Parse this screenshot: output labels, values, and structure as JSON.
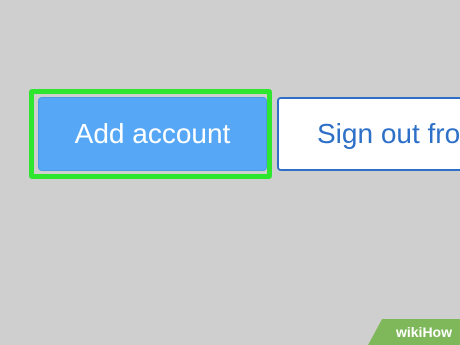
{
  "buttons": {
    "add_account_label": "Add account",
    "sign_out_label": "Sign out from"
  },
  "watermark": {
    "part1": "wiki",
    "part2": "How"
  },
  "colors": {
    "background": "#cfcfcf",
    "highlight": "#2ee62e",
    "primary_button": "#56a8f6",
    "secondary_border": "#2e70c8",
    "watermark_green": "#7fb85a"
  }
}
